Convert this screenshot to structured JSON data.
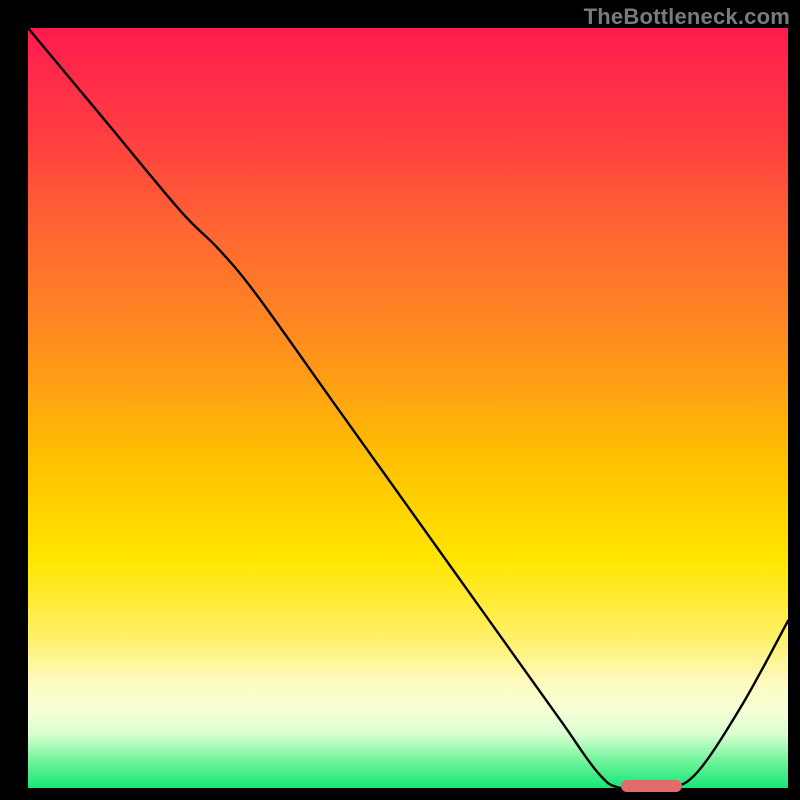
{
  "watermark": "TheBottleneck.com",
  "chart_data": {
    "type": "line",
    "title": "",
    "xlabel": "",
    "ylabel": "",
    "xlim": [
      0,
      100
    ],
    "ylim": [
      0,
      100
    ],
    "grid": false,
    "legend": false,
    "series": [
      {
        "name": "curve",
        "x": [
          0,
          10,
          20,
          25,
          30,
          40,
          50,
          60,
          70,
          75,
          78,
          84,
          88,
          94,
          100
        ],
        "y": [
          100,
          88,
          76,
          71,
          65,
          51,
          37,
          23,
          9,
          2,
          0,
          0,
          2,
          11,
          22
        ]
      }
    ],
    "marker": {
      "x_start": 78,
      "x_end": 86,
      "y": 0
    },
    "background_gradient": {
      "stops": [
        {
          "pos": 0,
          "color": "#ff1a4d"
        },
        {
          "pos": 15,
          "color": "#ff4040"
        },
        {
          "pos": 40,
          "color": "#ff8a20"
        },
        {
          "pos": 58,
          "color": "#ffc400"
        },
        {
          "pos": 70,
          "color": "#ffe600"
        },
        {
          "pos": 86,
          "color": "#fffac0"
        },
        {
          "pos": 93,
          "color": "#d6ffd0"
        },
        {
          "pos": 100,
          "color": "#17e676"
        }
      ]
    }
  }
}
